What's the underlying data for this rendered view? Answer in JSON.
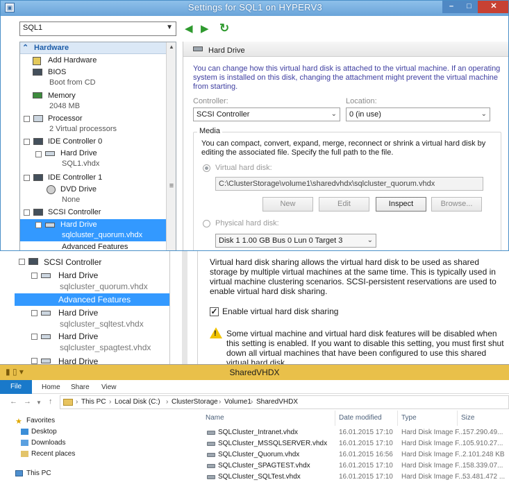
{
  "settings_window": {
    "title": "Settings for SQL1 on HYPERV3",
    "vm_selector": "SQL1",
    "section_header": "Hardware",
    "tree": [
      {
        "label": "Add Hardware"
      },
      {
        "label": "BIOS",
        "sub": "Boot from CD"
      },
      {
        "label": "Memory",
        "sub": "2048 MB"
      },
      {
        "label": "Processor",
        "sub": "2 Virtual processors"
      },
      {
        "label": "IDE Controller 0"
      },
      {
        "label": "Hard Drive",
        "sub": "SQL1.vhdx"
      },
      {
        "label": "IDE Controller 1"
      },
      {
        "label": "DVD Drive",
        "sub": "None"
      },
      {
        "label": "SCSI Controller"
      },
      {
        "label": "Hard Drive",
        "sub": "sqlcluster_quorum.vhdx"
      },
      {
        "label": "Advanced Features"
      }
    ],
    "details": {
      "heading": "Hard Drive",
      "description": "You can change how this virtual hard disk is attached to the virtual machine. If an operating system is installed on this disk, changing the attachment might prevent the virtual machine from starting.",
      "controller_label": "Controller:",
      "controller_value": "SCSI Controller",
      "location_label": "Location:",
      "location_value": "0 (in use)",
      "media_label": "Media",
      "media_description": "You can compact, convert, expand, merge, reconnect or shrink a virtual hard disk by editing the associated file. Specify the full path to the file.",
      "vhd_radio_label": "Virtual hard disk:",
      "vhd_path": "C:\\ClusterStorage\\volume1\\sharedvhdx\\sqlcluster_quorum.vhdx",
      "buttons": {
        "new": "New",
        "edit": "Edit",
        "inspect": "Inspect",
        "browse": "Browse..."
      },
      "physical_radio_label": "Physical hard disk:",
      "physical_value": "Disk 1 1.00 GB Bus 0 Lun 0 Target 3"
    }
  },
  "advanced_window": {
    "tree": [
      {
        "label": "SCSI Controller"
      },
      {
        "label": "Hard Drive",
        "sub": "sqlcluster_quorum.vhdx"
      },
      {
        "label": "Advanced Features"
      },
      {
        "label": "Hard Drive",
        "sub": "sqlcluster_sqltest.vhdx"
      },
      {
        "label": "Hard Drive",
        "sub": "sqlcluster_spagtest.vhdx"
      },
      {
        "label": "Hard Drive"
      }
    ],
    "sharing_description": "Virtual hard disk sharing allows the virtual hard disk to be used as shared storage by multiple virtual machines at the same time. This is typically used in virtual machine clustering scenarios. SCSI-persistent reservations are used to enable virtual hard disk sharing.",
    "enable_sharing_label": "Enable virtual hard disk sharing",
    "enable_sharing_checked": true,
    "warning_text": "Some virtual machine and virtual hard disk features will be disabled when this setting is enabled. If you want to disable this setting, you must first shut down all virtual machines that have been configured to use this shared virtual hard disk."
  },
  "explorer_window": {
    "title": "SharedVHDX",
    "ribbon_tabs": [
      "File",
      "Home",
      "Share",
      "View"
    ],
    "breadcrumb": [
      "This PC",
      "Local Disk (C:)",
      "ClusterStorage",
      "Volume1",
      "SharedVHDX"
    ],
    "nav": {
      "favorites": "Favorites",
      "items": [
        "Desktop",
        "Downloads",
        "Recent places"
      ],
      "this_pc": "This PC"
    },
    "columns": [
      "Name",
      "Date modified",
      "Type",
      "Size"
    ],
    "files": [
      {
        "name": "SQLCluster_Intranet.vhdx",
        "date": "16.01.2015 17:10",
        "type": "Hard Disk Image F...",
        "size": "157.290.49..."
      },
      {
        "name": "SQLCluster_MSSQLSERVER.vhdx",
        "date": "16.01.2015 17:10",
        "type": "Hard Disk Image F...",
        "size": "105.910.27..."
      },
      {
        "name": "SQLCluster_Quorum.vhdx",
        "date": "16.01.2015 16:56",
        "type": "Hard Disk Image F...",
        "size": "2.101.248 KB"
      },
      {
        "name": "SQLCluster_SPAGTEST.vhdx",
        "date": "16.01.2015 17:10",
        "type": "Hard Disk Image F...",
        "size": "158.339.07..."
      },
      {
        "name": "SQLCluster_SQLTest.vhdx",
        "date": "16.01.2015 17:10",
        "type": "Hard Disk Image F...",
        "size": "53.481.472 ..."
      }
    ]
  }
}
